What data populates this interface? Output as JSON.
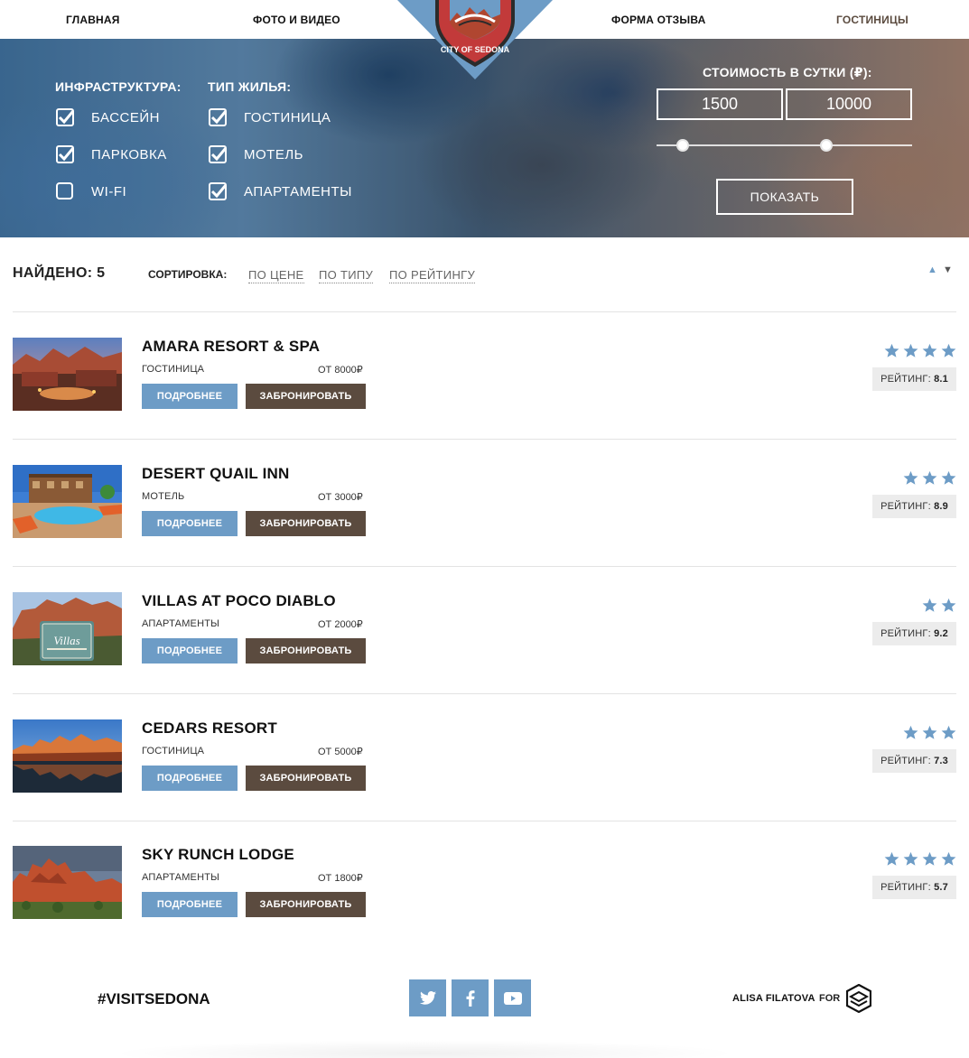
{
  "nav": {
    "items": [
      "ГЛАВНАЯ",
      "ФОТО И ВИДЕО",
      "ФОРМА ОТЗЫВА",
      "ГОСТИНИЦЫ"
    ],
    "active": "ГОСТИНИЦЫ",
    "logo_text": "CITY OF SEDONA"
  },
  "filters": {
    "infrastructure": {
      "title": "ИНФРАСТРУКТУРА:",
      "options": [
        {
          "label": "БАССЕЙН",
          "checked": true
        },
        {
          "label": "ПАРКОВКА",
          "checked": true
        },
        {
          "label": "WI-FI",
          "checked": false
        }
      ]
    },
    "housing_type": {
      "title": "ТИП ЖИЛЬЯ:",
      "options": [
        {
          "label": "ГОСТИНИЦА",
          "checked": true
        },
        {
          "label": "МОТЕЛЬ",
          "checked": true
        },
        {
          "label": "АПАРТАМЕНТЫ",
          "checked": true
        }
      ]
    },
    "price": {
      "title": "СТОИМОСТЬ В СУТКИ (₽):",
      "min": "1500",
      "max": "10000"
    },
    "show_button": "ПОКАЗАТЬ"
  },
  "results": {
    "found_label": "НАЙДЕНО: 5",
    "sort_label": "СОРТИРОВКА:",
    "sort_options": [
      "ПО ЦЕНЕ",
      "ПО ТИПУ",
      "ПО РЕЙТИНГУ"
    ],
    "sort_up": "▲",
    "sort_down": "▼"
  },
  "buttons": {
    "more": "ПОДРОБНЕЕ",
    "book": "ЗАБРОНИРОВАТЬ"
  },
  "rating_label": "РЕЙТИНГ:",
  "hotels": [
    {
      "name": "AMARA RESORT & SPA",
      "type": "ГОСТИНИЦА",
      "price": "ОТ 8000₽",
      "stars": 4,
      "rating": "8.1"
    },
    {
      "name": "DESERT QUAIL INN",
      "type": "МОТЕЛЬ",
      "price": "ОТ 3000₽",
      "stars": 3,
      "rating": "8.9"
    },
    {
      "name": "VILLAS AT POCO DIABLO",
      "type": "АПАРТАМЕНТЫ",
      "price": "ОТ 2000₽",
      "stars": 2,
      "rating": "9.2"
    },
    {
      "name": "CEDARS RESORT",
      "type": "ГОСТИНИЦА",
      "price": "ОТ 5000₽",
      "stars": 3,
      "rating": "7.3"
    },
    {
      "name": "SKY RUNCH LODGE",
      "type": "АПАРТАМЕНТЫ",
      "price": "ОТ 1800₽",
      "stars": 4,
      "rating": "5.7"
    }
  ],
  "footer": {
    "hashtag": "#VISITSEDONA",
    "social": [
      "twitter-icon",
      "facebook-icon",
      "youtube-icon"
    ],
    "author": "ALISA FILATOVA",
    "for": "FOR"
  },
  "colors": {
    "accent_blue": "#6d9cc6",
    "accent_brown": "#5b4b3f"
  }
}
